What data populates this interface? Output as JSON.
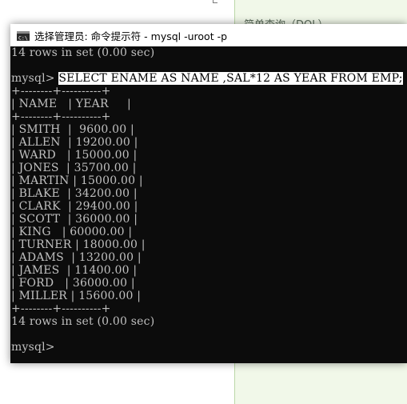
{
  "background_doc": {
    "heading": "简单查询（DQL）"
  },
  "window": {
    "title": "选择管理员: 命令提示符 - mysql  -uroot -p"
  },
  "console": {
    "lines": [
      {
        "text": "14 rows in set (0.00 sec)"
      },
      {
        "text": ""
      },
      {
        "prompt": "mysql> ",
        "command": "SELECT ENAME AS NAME ,SAL*12 AS YEAR FROM EMP;"
      },
      {
        "text": "+--------+----------+"
      },
      {
        "text": "| NAME   | YEAR     |"
      },
      {
        "text": "+--------+----------+"
      },
      {
        "text": "| SMITH  |  9600.00 |"
      },
      {
        "text": "| ALLEN  | 19200.00 |"
      },
      {
        "text": "| WARD   | 15000.00 |"
      },
      {
        "text": "| JONES  | 35700.00 |"
      },
      {
        "text": "| MARTIN | 15000.00 |"
      },
      {
        "text": "| BLAKE  | 34200.00 |"
      },
      {
        "text": "| CLARK  | 29400.00 |"
      },
      {
        "text": "| SCOTT  | 36000.00 |"
      },
      {
        "text": "| KING   | 60000.00 |"
      },
      {
        "text": "| TURNER | 18000.00 |"
      },
      {
        "text": "| ADAMS  | 13200.00 |"
      },
      {
        "text": "| JAMES  | 11400.00 |"
      },
      {
        "text": "| FORD   | 36000.00 |"
      },
      {
        "text": "| MILLER | 15600.00 |"
      },
      {
        "text": "+--------+----------+"
      },
      {
        "text": "14 rows in set (0.00 sec)"
      },
      {
        "text": ""
      },
      {
        "text": "mysql>"
      }
    ]
  },
  "icons": {
    "window_icon": "command-prompt-icon"
  }
}
